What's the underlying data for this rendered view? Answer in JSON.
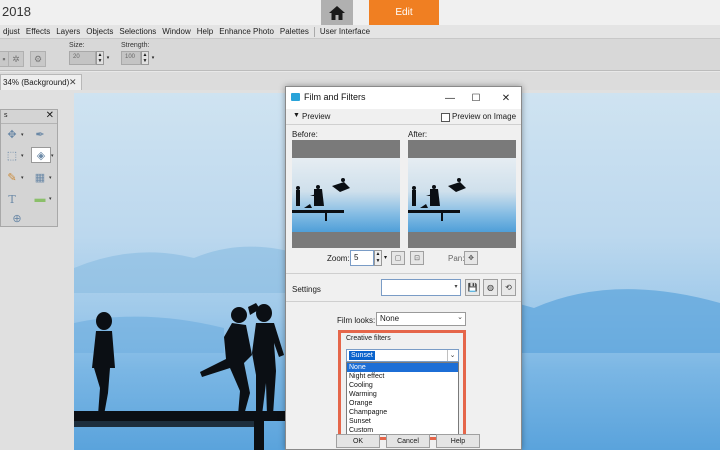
{
  "app": {
    "year_fragment": "2018",
    "edit_tab": "Edit"
  },
  "menubar": [
    "djust",
    "Effects",
    "Layers",
    "Objects",
    "Selections",
    "Window",
    "Help",
    "Enhance Photo",
    "Palettes",
    "User Interface"
  ],
  "options": {
    "size_label": "Size:",
    "size_value": "20",
    "strength_label": "Strength:",
    "strength_value": "100"
  },
  "doc_tab": {
    "label": "34% (Background)"
  },
  "tools_panel": {
    "title_fragment": "s"
  },
  "dialog": {
    "title": "Film and Filters",
    "preview_label": "Preview",
    "preview_on_image": "Preview on Image",
    "before_label": "Before:",
    "after_label": "After:",
    "zoom_label": "Zoom:",
    "zoom_value": "5",
    "pan_label": "Pan:",
    "settings_label": "Settings",
    "film_looks_label": "Film looks:",
    "film_looks_value": "None",
    "creative_filters_label": "Creative filters",
    "creative_filters_value": "Sunset",
    "creative_filters_options": [
      "None",
      "Night effect",
      "Cooling",
      "Warming",
      "Orange",
      "Champagne",
      "Sunset",
      "Custom"
    ],
    "highlighted_option": "None",
    "ok_label": "OK",
    "cancel_label": "Cancel",
    "help_label": "Help"
  },
  "colors": {
    "accent": "#f07f22",
    "highlight_box": "#e5664a",
    "selection": "#0a63cc"
  }
}
